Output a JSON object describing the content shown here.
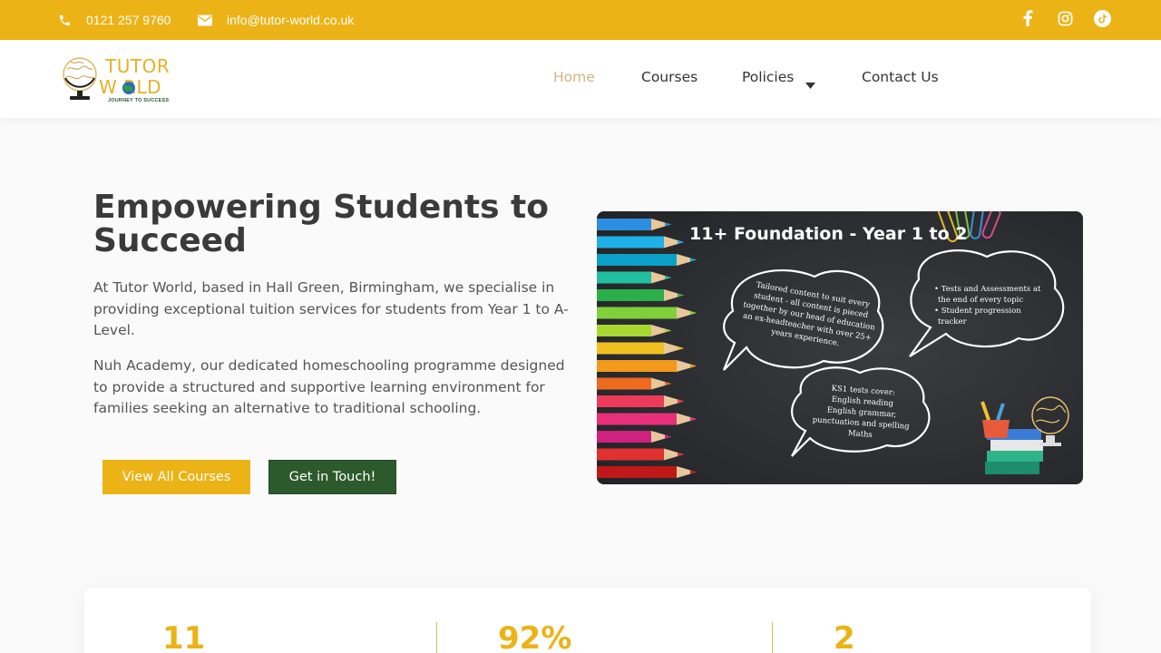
{
  "topbar": {
    "phone": "0121 257 9760",
    "email": "info@tutor-world.co.uk",
    "social": [
      "facebook-icon",
      "instagram-icon",
      "tiktok-icon"
    ]
  },
  "logo": {
    "line1": "TUTOR",
    "line2": "W   RLD",
    "tagline": "JOURNEY TO SUCCESS"
  },
  "nav": {
    "items": [
      {
        "label": "Home",
        "active": true
      },
      {
        "label": "Courses",
        "active": false
      },
      {
        "label": "Policies",
        "active": false,
        "dropdown": true
      },
      {
        "label": "Contact Us",
        "active": false
      }
    ]
  },
  "hero": {
    "title": "Empowering Students to Succeed",
    "paragraph1": "At Tutor World, based in Hall Green, Birmingham, we specialise in providing exceptional tuition services for students from Year 1 to A-Level.",
    "paragraph2": "Nuh Academy, our dedicated homeschooling programme designed to provide a structured and supportive learning environment for families seeking an alternative to traditional schooling.",
    "button_primary": "View All Courses",
    "button_secondary": "Get in Touch!"
  },
  "image": {
    "title": "11+ Foundation - Year 1 to 2",
    "bubble1": "Tailored content to suit every student - all content is pieced together by our head of education an ex-headteacher with over 25+ years experience.",
    "bubble2": [
      "• Tests and Assessments at",
      "the end of every topic",
      "• Student progression",
      "tracker"
    ],
    "bubble3": [
      "KS1 tests cover:",
      "English reading",
      "English grammar,",
      "punctuation and spelling",
      "Maths"
    ]
  },
  "stats": {
    "values": [
      "11",
      "92%",
      "2"
    ]
  },
  "colors": {
    "accent": "#ecb316",
    "green": "#2c5a2d",
    "nav_active": "#d4b482"
  }
}
